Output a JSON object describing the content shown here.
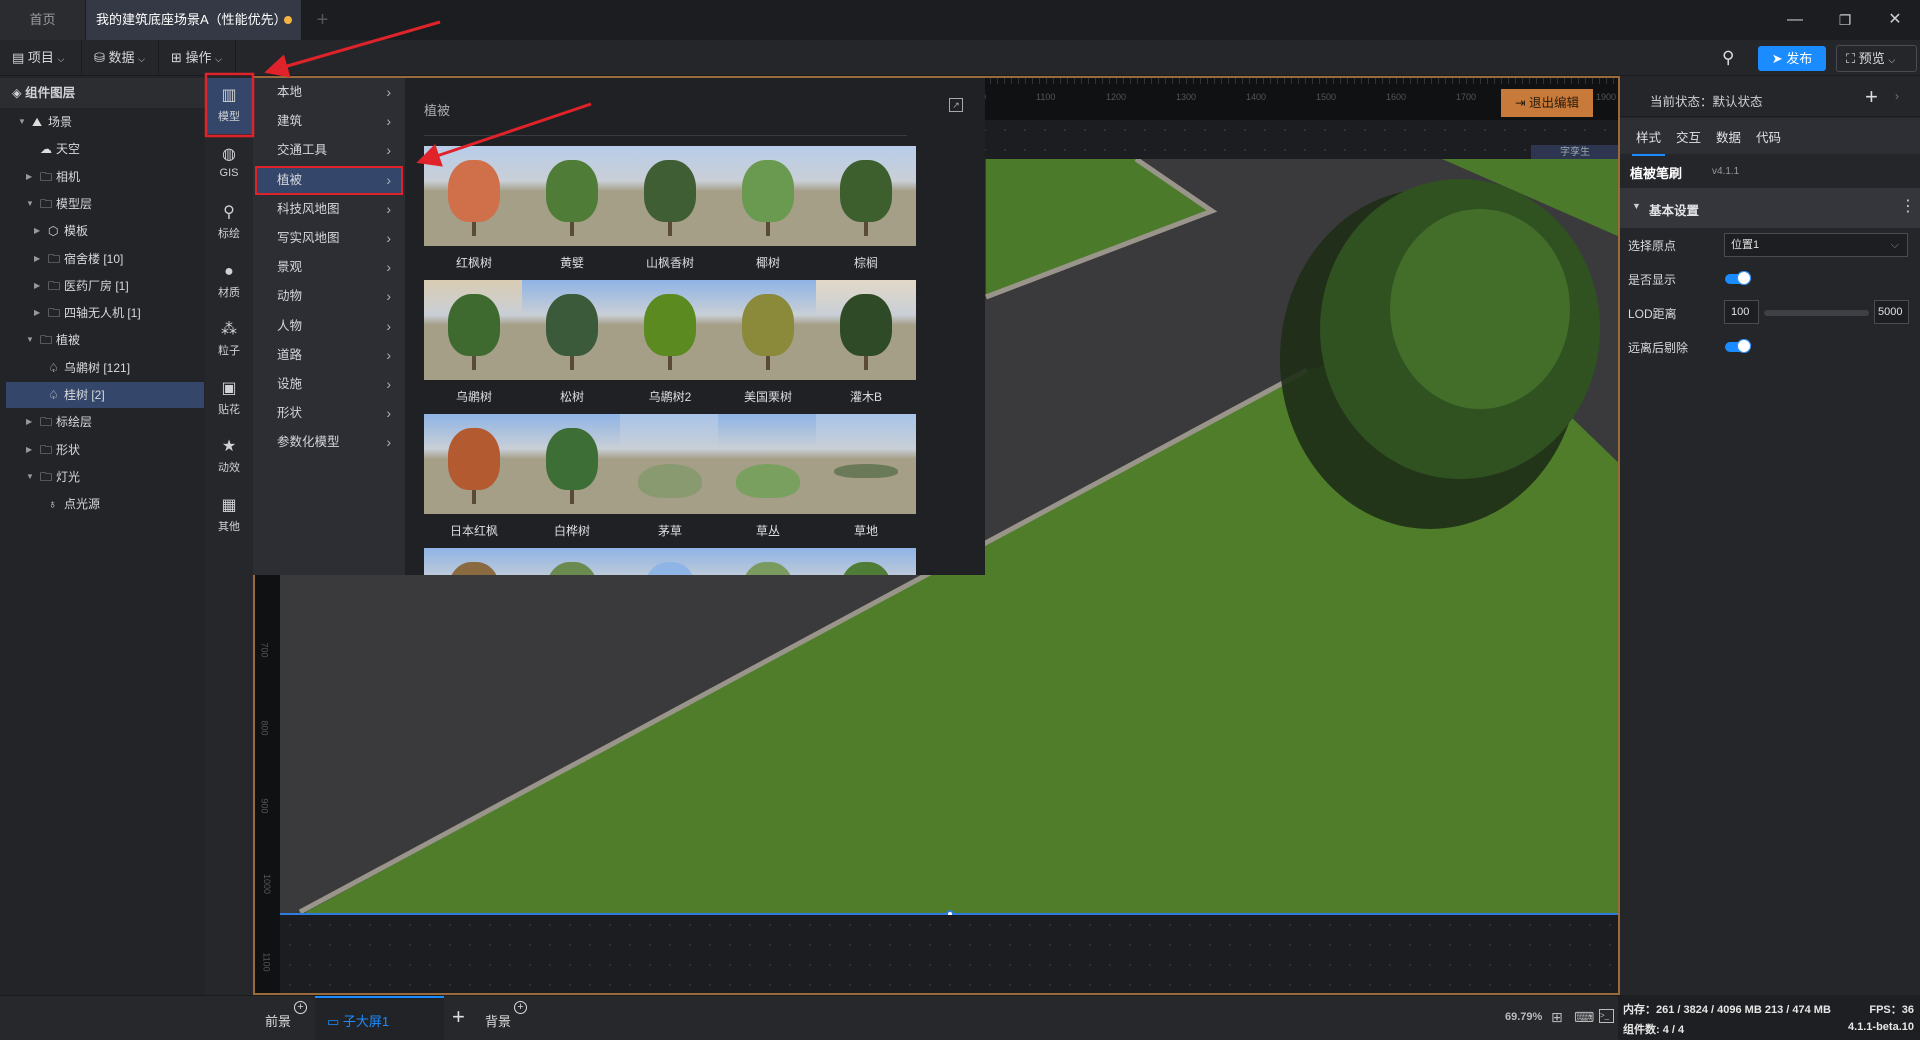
{
  "tabs": [
    {
      "label": "首页"
    },
    {
      "label": "我的建筑底座场景A（性能优先）",
      "modified_dot": "#f5b342"
    }
  ],
  "toolbar": {
    "project": "项目",
    "data": "数据",
    "operate": "操作",
    "publish": "发布",
    "preview": "预览"
  },
  "layers": {
    "title": "组件图层",
    "items": [
      {
        "label": "场景",
        "icon": "scene-icon",
        "level": 0,
        "arrow": "down"
      },
      {
        "label": "天空",
        "icon": "sky-icon",
        "level": 1,
        "arrow": ""
      },
      {
        "label": "相机",
        "icon": "folder-icon",
        "level": 1,
        "arrow": "right"
      },
      {
        "label": "模型层",
        "icon": "folder-icon",
        "level": 1,
        "arrow": "down"
      },
      {
        "label": "模板",
        "icon": "cube-icon",
        "level": 2,
        "arrow": "right"
      },
      {
        "label": "宿舍楼 [10]",
        "icon": "folder-icon",
        "level": 2,
        "arrow": "right"
      },
      {
        "label": "医药厂房 [1]",
        "icon": "folder-icon",
        "level": 2,
        "arrow": "right"
      },
      {
        "label": "四轴无人机 [1]",
        "icon": "folder-icon",
        "level": 2,
        "arrow": "right"
      },
      {
        "label": "植被",
        "icon": "folder-icon",
        "level": 1,
        "arrow": "down"
      },
      {
        "label": "乌鹕树 [121]",
        "icon": "tree-icon",
        "level": 2,
        "arrow": ""
      },
      {
        "label": "桂树 [2]",
        "icon": "tree-icon",
        "level": 2,
        "arrow": "",
        "selected": true
      },
      {
        "label": "标绘层",
        "icon": "folder-icon",
        "level": 1,
        "arrow": "right"
      },
      {
        "label": "形状",
        "icon": "folder-icon",
        "level": 1,
        "arrow": "right"
      },
      {
        "label": "灯光",
        "icon": "folder-icon",
        "level": 1,
        "arrow": "down"
      },
      {
        "label": "点光源",
        "icon": "bulb-icon",
        "level": 2,
        "arrow": ""
      }
    ]
  },
  "categories": [
    {
      "label": "模型",
      "icon": "building-icon",
      "selected": true
    },
    {
      "label": "GIS",
      "icon": "globe-icon"
    },
    {
      "label": "标绘",
      "icon": "pin-icon"
    },
    {
      "label": "材质",
      "icon": "sphere-icon"
    },
    {
      "label": "粒子",
      "icon": "particle-icon"
    },
    {
      "label": "贴花",
      "icon": "image-icon"
    },
    {
      "label": "动效",
      "icon": "star-icon"
    },
    {
      "label": "其他",
      "icon": "grid-icon"
    }
  ],
  "menu": [
    "本地",
    "建筑",
    "交通工具",
    "植被",
    "科技风地图",
    "写实风地图",
    "景观",
    "动物",
    "人物",
    "道路",
    "设施",
    "形状",
    "参数化模型"
  ],
  "menu_selected": "植被",
  "gallery": {
    "title": "植被",
    "items": [
      {
        "label": "红枫树",
        "foliage": "#d0704a",
        "sky": "#b8cdea"
      },
      {
        "label": "黄嬖",
        "foliage": "#4f7d38",
        "sky": "#b8cdea"
      },
      {
        "label": "山枫香树",
        "foliage": "#3f5e34",
        "sky": "#b8cdea"
      },
      {
        "label": "椰树",
        "foliage": "#6a9a50",
        "sky": "#b8cdea"
      },
      {
        "label": "棕榈",
        "foliage": "#3d5f2e",
        "sky": "#b8cdea"
      },
      {
        "label": "乌鹕树",
        "foliage": "#3e6a30",
        "sky": "#d9ccb2"
      },
      {
        "label": "松树",
        "foliage": "#3a5a3a",
        "sky": "#8fb4e6"
      },
      {
        "label": "乌鹕树2",
        "foliage": "#5a8a20",
        "sky": "#8fb4e6"
      },
      {
        "label": "美国栗树",
        "foliage": "#8a8a3a",
        "sky": "#8fb4e6"
      },
      {
        "label": "灌木B",
        "foliage": "#2f4a26",
        "sky": "#e2d8c8"
      },
      {
        "label": "日本红枫",
        "foliage": "#b45a30",
        "sky": "#8fb4e6"
      },
      {
        "label": "白桦树",
        "foliage": "#3d6e35",
        "sky": "#8fb4e6"
      },
      {
        "label": "茅草",
        "foliage": "#8a9a70",
        "sky": "#a8c4ea"
      },
      {
        "label": "草丛",
        "foliage": "#7aa060",
        "sky": "#8fb4e6"
      },
      {
        "label": "草地",
        "foliage": "#6a7a58",
        "sky": "#a8c4ea"
      },
      {
        "label": "",
        "foliage": "#8a6a40",
        "sky": "#8fb4e6"
      },
      {
        "label": "",
        "foliage": "#6a8a50",
        "sky": "#8fb4e6"
      },
      {
        "label": "",
        "foliage": "#8fb4e6",
        "sky": "#8fb4e6"
      },
      {
        "label": "",
        "foliage": "#7a9a60",
        "sky": "#8fb4e6"
      },
      {
        "label": "",
        "foliage": "#4f7d38",
        "sky": "#8fb4e6"
      }
    ]
  },
  "canvas": {
    "ruler_top": [
      "1000",
      "1100",
      "1200",
      "1300",
      "1400",
      "1500",
      "1600",
      "1700",
      "1800",
      "1900"
    ],
    "ruler_left": [
      "700",
      "800",
      "900",
      "1000",
      "1100"
    ],
    "exit_edit": "退出编辑",
    "twin_tag": "字孪生",
    "grass": "#4f7d2a",
    "asphalt": "#3a3a3c"
  },
  "right": {
    "state_label": "当前状态：默认状态",
    "tabs": [
      "样式",
      "交互",
      "数据",
      "代码"
    ],
    "component": "植被笔刷",
    "version": "v4.1.1",
    "section": "基本设置",
    "origin_label": "选择原点",
    "origin_value": "位置1",
    "show_label": "是否显示",
    "show_on": true,
    "lod_label": "LOD距离",
    "lod_min": "100",
    "lod_max": "5000",
    "cull_label": "远离后剔除",
    "cull_on": true
  },
  "bottom": {
    "foreground": "前景",
    "screen_tab": "子大屏1",
    "background": "背景",
    "zoom": "69.79%"
  },
  "status": {
    "memory": "内存：261 / 3824 / 4096 MB  213 / 474 MB",
    "fps": "FPS：36",
    "components": "组件数: 4 / 4",
    "build": "4.1.1-beta.10"
  },
  "accent": "#1a8cff"
}
